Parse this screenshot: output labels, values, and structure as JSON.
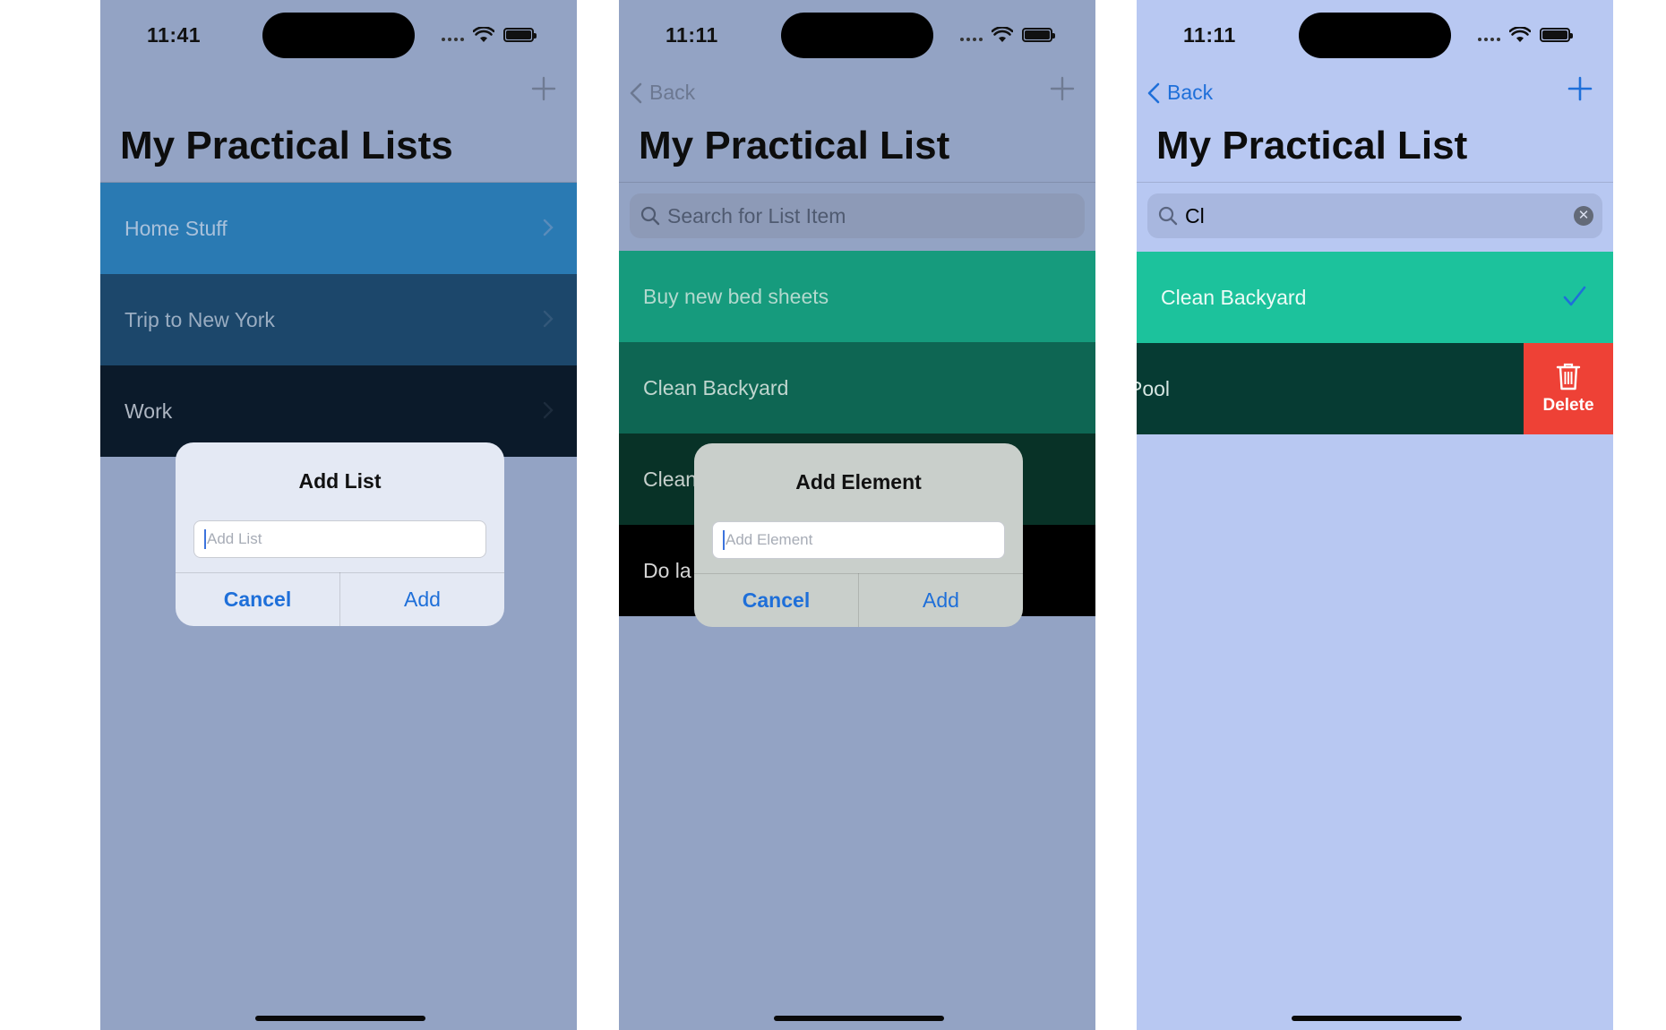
{
  "colors": {
    "accent_blue": "#1e6fd9",
    "delete_red": "#ee4136",
    "screen1_bg": "#93a3c4",
    "screen3_bg": "#b8c8f2"
  },
  "screen1": {
    "status_time": "11:41",
    "title": "My Practical Lists",
    "add_icon": "plus-icon",
    "rows": [
      {
        "label": "Home Stuff",
        "color": "#2a7ab3"
      },
      {
        "label": "Trip to New York",
        "color": "#1c476b"
      },
      {
        "label": "Work",
        "color": "#0b1a2a"
      }
    ],
    "dialog": {
      "title": "Add List",
      "placeholder": "Add List",
      "cancel": "Cancel",
      "confirm": "Add"
    }
  },
  "screen2": {
    "status_time": "11:11",
    "back_label": "Back",
    "title": "My Practical List",
    "search_placeholder": "Search for List Item",
    "rows": [
      {
        "label": "Buy new bed sheets",
        "color": "#169b7d"
      },
      {
        "label": "Clean Backyard",
        "color": "#0e6653"
      },
      {
        "label": "Clean",
        "color": "#083227"
      },
      {
        "label": "Do la",
        "color": "#000000"
      }
    ],
    "dialog": {
      "title": "Add Element",
      "placeholder": "Add Element",
      "cancel": "Cancel",
      "confirm": "Add"
    }
  },
  "screen3": {
    "status_time": "11:11",
    "back_label": "Back",
    "title": "My Practical List",
    "search_value": "Cl",
    "rows": [
      {
        "label": "Clean Backyard",
        "color": "#1cc29c",
        "checked": true
      },
      {
        "label": "Pool",
        "color": "#063b33"
      }
    ],
    "delete_label": "Delete"
  }
}
